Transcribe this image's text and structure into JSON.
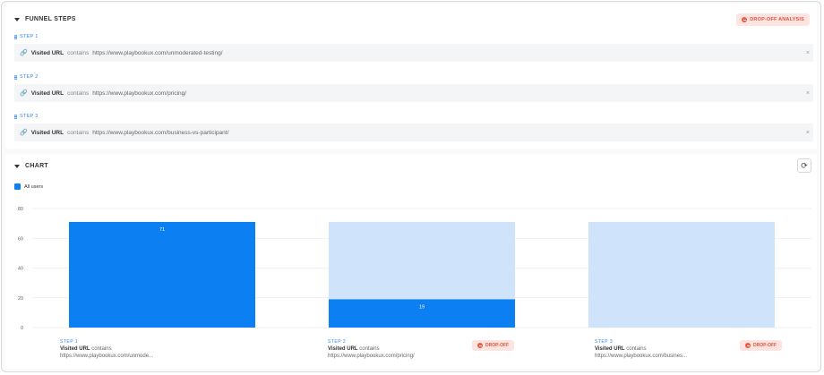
{
  "funnel": {
    "title": "FUNNEL STEPS",
    "dropoff_analysis_label": "DROP-OFF ANALYSIS",
    "steps": [
      {
        "label": "STEP 1",
        "field": "Visited URL",
        "operator": "contains",
        "value": "https://www.playbookux.com/unmoderated-testing/"
      },
      {
        "label": "STEP 2",
        "field": "Visited URL",
        "operator": "contains",
        "value": "https://www.playbookux.com/pricing/"
      },
      {
        "label": "STEP 3",
        "field": "Visited URL",
        "operator": "contains",
        "value": "https://www.playbookux.com/business-vs-participant/"
      }
    ],
    "remove_icon": "×"
  },
  "chart_section": {
    "title": "CHART",
    "refresh_icon": "⟳",
    "legend_label": "All users",
    "bottom": [
      {
        "step": "STEP 1",
        "field": "Visited URL",
        "operator": "contains",
        "url": "https://www.playbookux.com/unmode..."
      },
      {
        "step": "STEP 2",
        "field": "Visited URL",
        "operator": "contains",
        "url": "https://www.playbookux.com/pricing/",
        "dropoff_label": "DROP-OFF"
      },
      {
        "step": "STEP 3",
        "field": "Visited URL",
        "operator": "contains",
        "url": "https://www.playbookux.com/busines...",
        "dropoff_label": "DROP-OFF"
      }
    ]
  },
  "chart_data": {
    "type": "bar",
    "categories": [
      "STEP 1",
      "STEP 2",
      "STEP 3"
    ],
    "series": [
      {
        "name": "All users",
        "values": [
          71,
          19,
          0
        ]
      }
    ],
    "data_labels": [
      "71",
      "19",
      ""
    ],
    "yticks": [
      0,
      20,
      40,
      60,
      80
    ],
    "ylim": [
      0,
      80
    ],
    "grid": true,
    "legend_position": "top-left",
    "colors": {
      "bar": "#0c7ff2",
      "bar_background": "#cfe3fb",
      "grid": "#e6e6e6"
    }
  }
}
